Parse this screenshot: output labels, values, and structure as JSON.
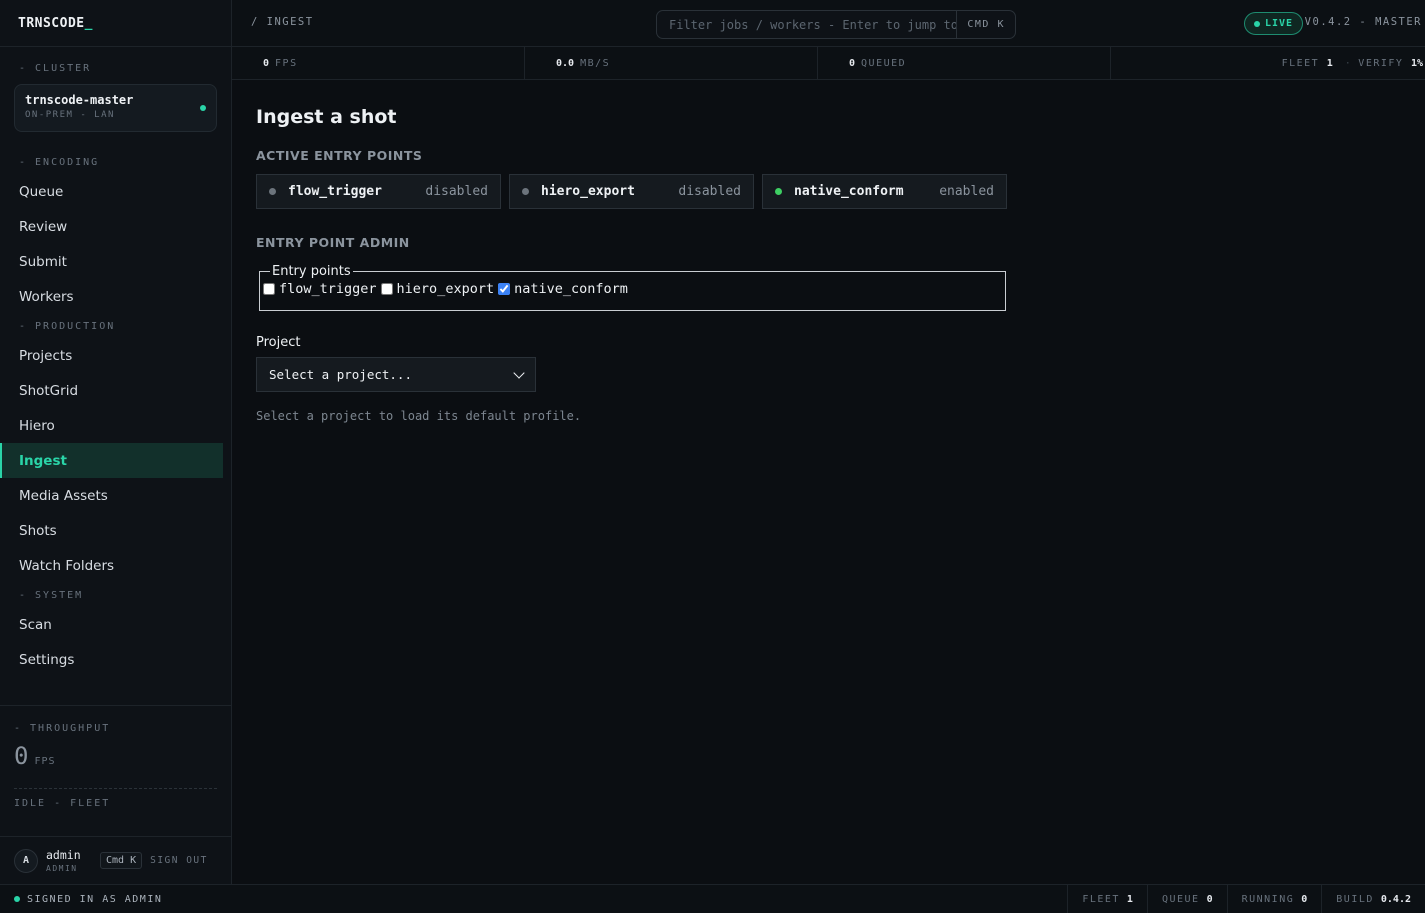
{
  "brand": {
    "name": "TRNSCODE",
    "cursor": "_"
  },
  "sidebar": {
    "cluster_label": "- CLUSTER",
    "cluster": {
      "name": "trnscode-master",
      "sub": "ON-PREM - LAN"
    },
    "sections": [
      {
        "label": "- ENCODING",
        "items": [
          {
            "label": "Queue"
          },
          {
            "label": "Review"
          },
          {
            "label": "Submit"
          },
          {
            "label": "Workers"
          }
        ]
      },
      {
        "label": "- PRODUCTION",
        "items": [
          {
            "label": "Projects"
          },
          {
            "label": "ShotGrid"
          },
          {
            "label": "Hiero"
          },
          {
            "label": "Ingest",
            "active": true
          },
          {
            "label": "Media Assets"
          },
          {
            "label": "Shots"
          },
          {
            "label": "Watch Folders"
          }
        ]
      },
      {
        "label": "- SYSTEM",
        "items": [
          {
            "label": "Scan"
          },
          {
            "label": "Settings"
          }
        ]
      }
    ],
    "throughput": {
      "label": "- THROUGHPUT",
      "value": "0",
      "unit": "FPS",
      "status": "IDLE - FLEET"
    },
    "user": {
      "initial": "A",
      "name": "admin",
      "role": "ADMIN",
      "shortcut": "Cmd K",
      "signout": "SIGN OUT"
    }
  },
  "topbar": {
    "breadcrumb": "/ INGEST",
    "search_placeholder": "Filter jobs / workers - Enter to jump to job",
    "search_shortcut": "CMD K",
    "live_label": "LIVE",
    "version": "V0.4.2 - MASTER"
  },
  "stats": {
    "fps": {
      "value": "0",
      "unit": "FPS"
    },
    "mbs": {
      "value": "0.0",
      "unit": "MB/S"
    },
    "queued": {
      "value": "0",
      "unit": "QUEUED"
    },
    "fleet_label": "FLEET",
    "fleet_value": "1",
    "verify_label": "VERIFY",
    "verify_value": "1%"
  },
  "main": {
    "title": "Ingest a shot",
    "active_heading": "ACTIVE ENTRY POINTS",
    "entry_points": [
      {
        "name": "flow_trigger",
        "status": "disabled",
        "enabled": false
      },
      {
        "name": "hiero_export",
        "status": "disabled",
        "enabled": false
      },
      {
        "name": "native_conform",
        "status": "enabled",
        "enabled": true
      }
    ],
    "admin_heading": "ENTRY POINT ADMIN",
    "admin_legend": "Entry points",
    "project_label": "Project",
    "project_select": "Select a project...",
    "hint": "Select a project to load its default profile."
  },
  "footer": {
    "signed_in": "SIGNED IN AS ADMIN",
    "fleet_label": "FLEET",
    "fleet_value": "1",
    "queue_label": "QUEUE",
    "queue_value": "0",
    "running_label": "RUNNING",
    "running_value": "0",
    "build_label": "BUILD",
    "build_value": "0.4.2"
  },
  "colors": {
    "accent": "#2ad4a8",
    "enabled_dot": "#3ecf63",
    "disabled_dot": "#6c747c",
    "background": "#0b0e12"
  }
}
